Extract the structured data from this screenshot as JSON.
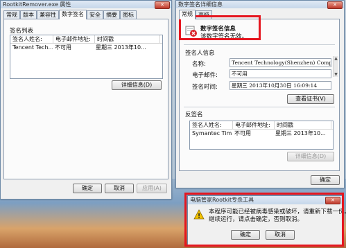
{
  "left_window": {
    "title": "RootkitRemover.exe 属性",
    "close_glyph": "✕",
    "tabs": [
      "常规",
      "版本",
      "兼容性",
      "数字签名",
      "安全",
      "摘要",
      "图标"
    ],
    "group_title": "签名列表",
    "list": {
      "headers": [
        "签名人姓名:",
        "电子邮件地址:",
        "时间戳"
      ],
      "rows": [
        [
          "Tencent Tech...",
          "不可用",
          "星期三 2013年10..."
        ]
      ]
    },
    "details_button": "详细信息(D)",
    "buttons": {
      "ok": "确定",
      "cancel": "取消",
      "apply": "应用(A)"
    }
  },
  "right_window": {
    "title": "数字签名详细信息",
    "close_glyph": "✕",
    "tabs": [
      "常规",
      "高级"
    ],
    "sig_info_title": "数字签名信息",
    "sig_info_text": "该数字签名无效。",
    "signer_group": "签名人信息",
    "fields": [
      {
        "label": "名称:",
        "value": "Tencent Technology(Shenzhen) Company L"
      },
      {
        "label": "电子邮件:",
        "value": "不可用"
      },
      {
        "label": "签名时间:",
        "value": "星期三 2013年10月30日 16:09:14"
      }
    ],
    "view_cert_button": "查看证书(V)",
    "countersign_group": "反签名",
    "list": {
      "headers": [
        "签名人姓名:",
        "电子邮件地址:",
        "时间戳"
      ],
      "rows": [
        [
          "Symantec Tim...",
          "不可用",
          "星期三 2013年10..."
        ]
      ]
    },
    "details_button": "详细信息(D)",
    "ok_button": "确定"
  },
  "dialog": {
    "title": "电脑管家Rootkit专杀工具",
    "close_glyph": "✕",
    "message_line1": "本程序可能已经被病毒感染或破坏，请重新下载一份。",
    "message_line2": "继续运行，请点击确定，否则取消。",
    "warning_glyph": "!",
    "ok_button": "确定",
    "cancel_button": "取消"
  },
  "colors": {
    "highlight_red": "#e5161f",
    "error_red": "#d9262c",
    "warning_yellow": "#f2c200"
  }
}
